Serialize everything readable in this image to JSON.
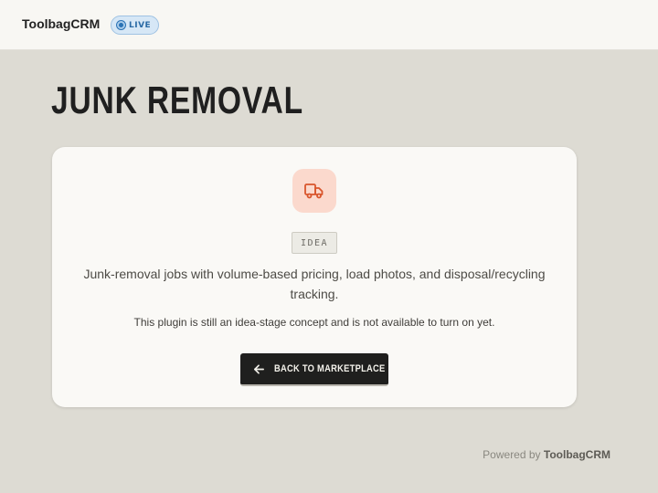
{
  "header": {
    "brand": "ToolbagCRM",
    "status_badge": "LIVE"
  },
  "page": {
    "title": "JUNK REMOVAL"
  },
  "card": {
    "icon": "truck-icon",
    "tag": "IDEA",
    "description": "Junk-removal jobs with volume-based pricing, load photos, and disposal/recycling tracking.",
    "note": "This plugin is still an idea-stage concept and is not available to turn on yet.",
    "back_button_label": "BACK TO MARKETPLACE",
    "back_button_icon": "arrow-left-icon"
  },
  "footer": {
    "prefix": "Powered by",
    "brand": "ToolbagCRM"
  },
  "colors": {
    "page_background": "#dddbd3",
    "accent": "#d9552c",
    "live_badge": "#2a72b5"
  }
}
